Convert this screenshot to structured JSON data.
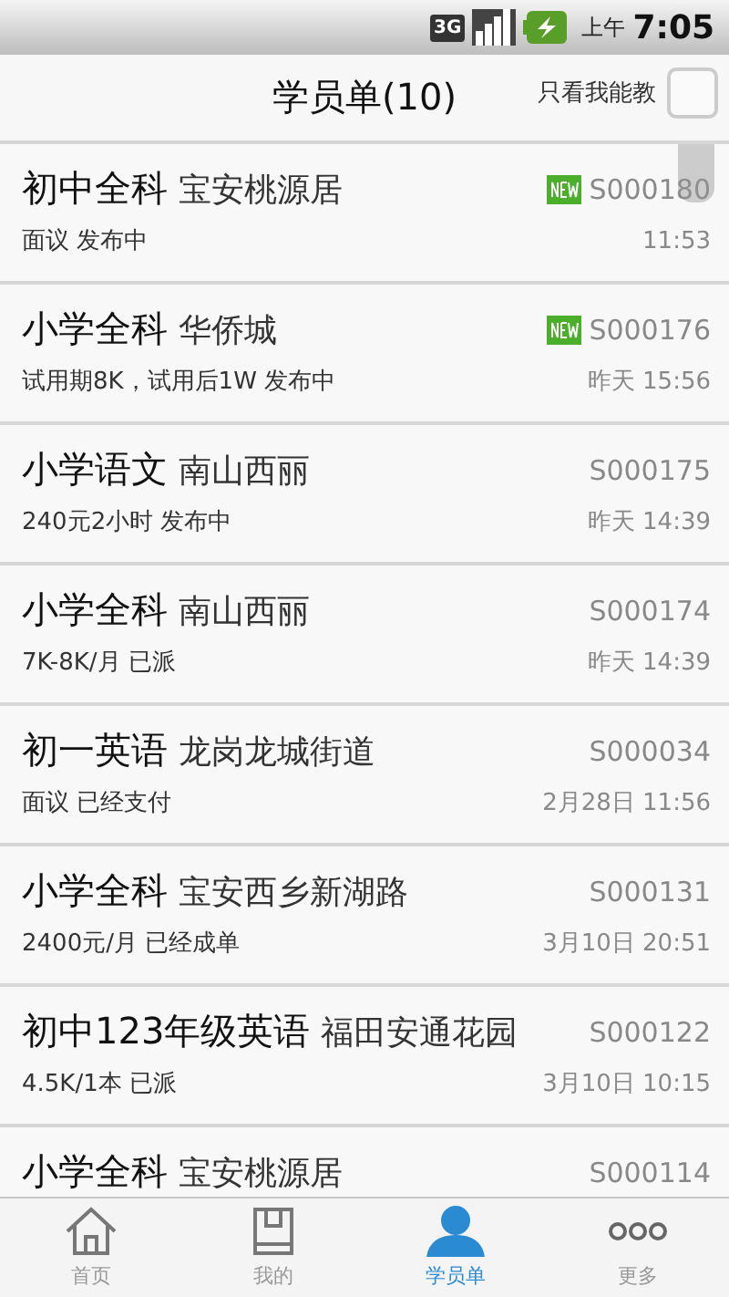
{
  "status_bar": {
    "network": "3G",
    "ampm": "上午",
    "time": "7:05"
  },
  "header": {
    "title": "学员单(10)",
    "filter": {
      "label": "只看我能教",
      "checked": false
    }
  },
  "rows": [
    {
      "subject": "初中全科",
      "place": "宝安桃源居",
      "detail": "面议 发布中",
      "code": "S000180",
      "time": "11:53",
      "new": true
    },
    {
      "subject": "小学全科",
      "place": "华侨城",
      "detail": "试用期8K，试用后1W 发布中",
      "code": "S000176",
      "time": "昨天 15:56",
      "new": true
    },
    {
      "subject": "小学语文",
      "place": "南山西丽",
      "detail": "240元2小时 发布中",
      "code": "S000175",
      "time": "昨天 14:39",
      "new": false
    },
    {
      "subject": "小学全科",
      "place": "南山西丽",
      "detail": "7K-8K/月 已派",
      "code": "S000174",
      "time": "昨天 14:39",
      "new": false
    },
    {
      "subject": "初一英语",
      "place": "龙岗龙城街道",
      "detail": "面议 已经支付",
      "code": "S000034",
      "time": "2月28日 11:56",
      "new": false
    },
    {
      "subject": "小学全科",
      "place": "宝安西乡新湖路",
      "detail": "2400元/月 已经成单",
      "code": "S000131",
      "time": "3月10日 20:51",
      "new": false
    },
    {
      "subject": "初中123年级英语",
      "place": "福田安通花园",
      "detail": "4.5K/1本 已派",
      "code": "S000122",
      "time": "3月10日 10:15",
      "new": false
    },
    {
      "subject": "小学全科",
      "place": "宝安桃源居",
      "code": "S000114",
      "new": false
    }
  ],
  "tabs": [
    {
      "label": "首页",
      "selected": false
    },
    {
      "label": "我的",
      "selected": false
    },
    {
      "label": "学员单",
      "selected": true
    },
    {
      "label": "更多",
      "selected": false
    }
  ]
}
